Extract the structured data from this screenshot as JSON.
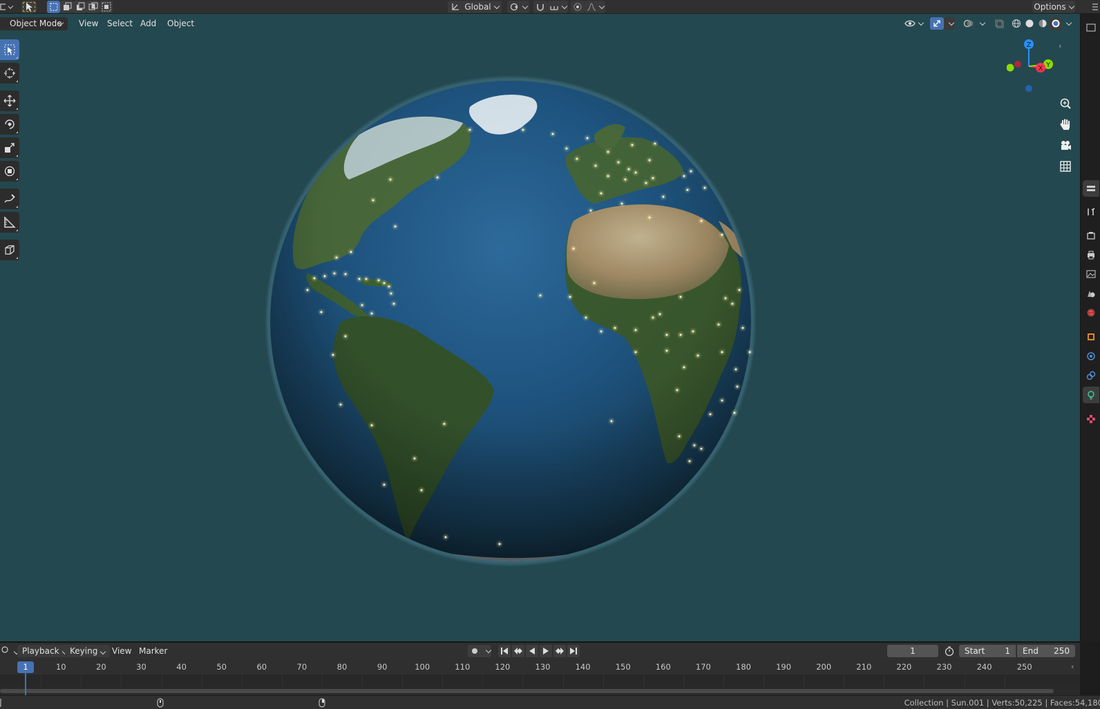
{
  "header": {
    "transform_orientation": "Global",
    "options_label": "Options"
  },
  "viewport_header": {
    "mode": "Object Mode",
    "menus": [
      "View",
      "Select",
      "Add",
      "Object"
    ]
  },
  "toolbar": {
    "tools": [
      "select-box",
      "cursor",
      "move",
      "rotate",
      "scale",
      "transform",
      "annotate",
      "measure",
      "add-cube"
    ],
    "active_tool": "select-box"
  },
  "gizmo": {
    "axes": [
      "X",
      "Y",
      "Z"
    ],
    "colors": {
      "x": "#ff3352",
      "y": "#8bdc00",
      "z": "#2890ff"
    }
  },
  "nav_buttons": [
    "zoom-icon",
    "pan-hand-icon",
    "camera-icon",
    "grid-icon"
  ],
  "properties_tabs": [
    "tool",
    "render",
    "output",
    "view-layer",
    "scene",
    "world",
    "object",
    "modifiers",
    "physics",
    "object-data-light",
    "texture"
  ],
  "properties_active_tab": "object-data-light",
  "timeline": {
    "menus": [
      "Playback",
      "Keying",
      "View",
      "Marker"
    ],
    "current_frame": "1",
    "start_label": "Start",
    "start_value": "1",
    "end_label": "End",
    "end_value": "250",
    "ruler_ticks": [
      "1",
      "10",
      "20",
      "30",
      "40",
      "50",
      "60",
      "70",
      "80",
      "90",
      "100",
      "110",
      "120",
      "130",
      "140",
      "150",
      "160",
      "170",
      "180",
      "190",
      "200",
      "210",
      "220",
      "230",
      "240",
      "250"
    ]
  },
  "statusbar": {
    "text": "Collection | Sun.001 | Verts:50,225 | Faces:54,180"
  },
  "colors": {
    "viewport_bg": "#24484f",
    "accent": "#4772b3",
    "ocean": "#1f4f79",
    "land": "#3d5c2c",
    "desert": "#b7a37e",
    "city_lights": "#fff3a6"
  }
}
